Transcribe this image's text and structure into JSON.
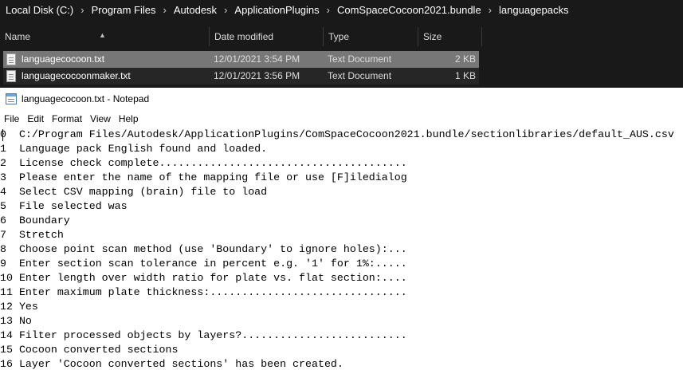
{
  "explorer": {
    "breadcrumb": [
      "Local Disk (C:)",
      "Program Files",
      "Autodesk",
      "ApplicationPlugins",
      "ComSpaceCocoon2021.bundle",
      "languagepacks"
    ],
    "separator": "›",
    "columns": {
      "name": "Name",
      "date": "Date modified",
      "type": "Type",
      "size": "Size"
    },
    "files": [
      {
        "name": "languagecocoon.txt",
        "date": "12/01/2021 3:54 PM",
        "type": "Text Document",
        "size": "2 KB"
      },
      {
        "name": "languagecocoonmaker.txt",
        "date": "12/01/2021 3:56 PM",
        "type": "Text Document",
        "size": "1 KB"
      }
    ],
    "icon": "text-file-icon"
  },
  "notepad": {
    "title": "languagecocoon.txt - Notepad",
    "icon": "notepad-icon",
    "menu": [
      "File",
      "Edit",
      "Format",
      "View",
      "Help"
    ],
    "lines": [
      "0  C:/Program Files/Autodesk/ApplicationPlugins/ComSpaceCocoon2021.bundle/sectionlibraries/default_AUS.csv",
      "1  Language pack English found and loaded.",
      "2  License check complete.......................................",
      "3  Please enter the name of the mapping file or use [F]iledialog",
      "4  Select CSV mapping (brain) file to load",
      "5  File selected was",
      "6  Boundary",
      "7  Stretch",
      "8  Choose point scan method (use 'Boundary' to ignore holes):...",
      "9  Enter section scan tolerance in percent e.g. '1' for 1%:.....",
      "10 Enter length over width ratio for plate vs. flat section:....",
      "11 Enter maximum plate thickness:...............................",
      "12 Yes",
      "13 No",
      "14 Filter processed objects by layers?..........................",
      "15 Cocoon converted sections",
      "16 Layer 'Cocoon converted sections' has been created."
    ]
  },
  "colors": {
    "explorer_bg": "#191919",
    "selection": "#777777",
    "editor_bg": "#ffffff"
  }
}
